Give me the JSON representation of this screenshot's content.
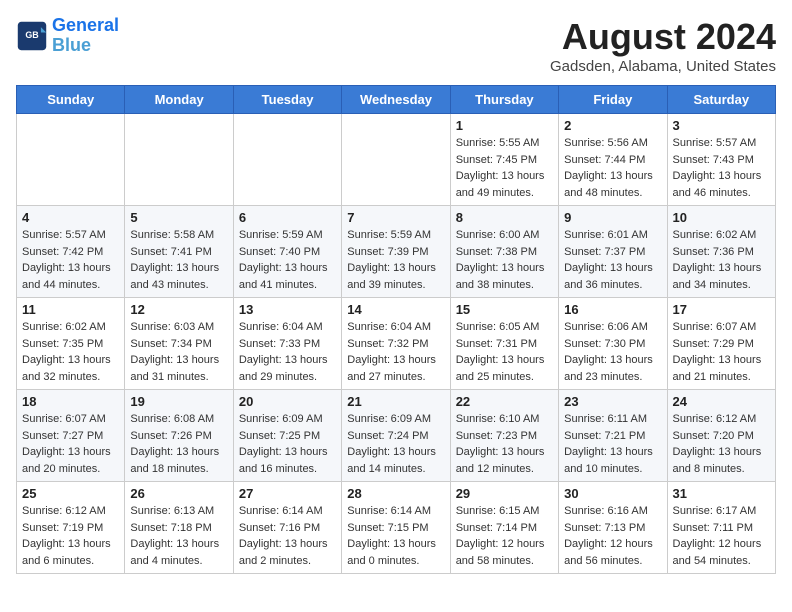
{
  "logo": {
    "line1": "General",
    "line2": "Blue"
  },
  "title": "August 2024",
  "location": "Gadsden, Alabama, United States",
  "days_of_week": [
    "Sunday",
    "Monday",
    "Tuesday",
    "Wednesday",
    "Thursday",
    "Friday",
    "Saturday"
  ],
  "weeks": [
    [
      {
        "day": "",
        "info": ""
      },
      {
        "day": "",
        "info": ""
      },
      {
        "day": "",
        "info": ""
      },
      {
        "day": "",
        "info": ""
      },
      {
        "day": "1",
        "info": "Sunrise: 5:55 AM\nSunset: 7:45 PM\nDaylight: 13 hours\nand 49 minutes."
      },
      {
        "day": "2",
        "info": "Sunrise: 5:56 AM\nSunset: 7:44 PM\nDaylight: 13 hours\nand 48 minutes."
      },
      {
        "day": "3",
        "info": "Sunrise: 5:57 AM\nSunset: 7:43 PM\nDaylight: 13 hours\nand 46 minutes."
      }
    ],
    [
      {
        "day": "4",
        "info": "Sunrise: 5:57 AM\nSunset: 7:42 PM\nDaylight: 13 hours\nand 44 minutes."
      },
      {
        "day": "5",
        "info": "Sunrise: 5:58 AM\nSunset: 7:41 PM\nDaylight: 13 hours\nand 43 minutes."
      },
      {
        "day": "6",
        "info": "Sunrise: 5:59 AM\nSunset: 7:40 PM\nDaylight: 13 hours\nand 41 minutes."
      },
      {
        "day": "7",
        "info": "Sunrise: 5:59 AM\nSunset: 7:39 PM\nDaylight: 13 hours\nand 39 minutes."
      },
      {
        "day": "8",
        "info": "Sunrise: 6:00 AM\nSunset: 7:38 PM\nDaylight: 13 hours\nand 38 minutes."
      },
      {
        "day": "9",
        "info": "Sunrise: 6:01 AM\nSunset: 7:37 PM\nDaylight: 13 hours\nand 36 minutes."
      },
      {
        "day": "10",
        "info": "Sunrise: 6:02 AM\nSunset: 7:36 PM\nDaylight: 13 hours\nand 34 minutes."
      }
    ],
    [
      {
        "day": "11",
        "info": "Sunrise: 6:02 AM\nSunset: 7:35 PM\nDaylight: 13 hours\nand 32 minutes."
      },
      {
        "day": "12",
        "info": "Sunrise: 6:03 AM\nSunset: 7:34 PM\nDaylight: 13 hours\nand 31 minutes."
      },
      {
        "day": "13",
        "info": "Sunrise: 6:04 AM\nSunset: 7:33 PM\nDaylight: 13 hours\nand 29 minutes."
      },
      {
        "day": "14",
        "info": "Sunrise: 6:04 AM\nSunset: 7:32 PM\nDaylight: 13 hours\nand 27 minutes."
      },
      {
        "day": "15",
        "info": "Sunrise: 6:05 AM\nSunset: 7:31 PM\nDaylight: 13 hours\nand 25 minutes."
      },
      {
        "day": "16",
        "info": "Sunrise: 6:06 AM\nSunset: 7:30 PM\nDaylight: 13 hours\nand 23 minutes."
      },
      {
        "day": "17",
        "info": "Sunrise: 6:07 AM\nSunset: 7:29 PM\nDaylight: 13 hours\nand 21 minutes."
      }
    ],
    [
      {
        "day": "18",
        "info": "Sunrise: 6:07 AM\nSunset: 7:27 PM\nDaylight: 13 hours\nand 20 minutes."
      },
      {
        "day": "19",
        "info": "Sunrise: 6:08 AM\nSunset: 7:26 PM\nDaylight: 13 hours\nand 18 minutes."
      },
      {
        "day": "20",
        "info": "Sunrise: 6:09 AM\nSunset: 7:25 PM\nDaylight: 13 hours\nand 16 minutes."
      },
      {
        "day": "21",
        "info": "Sunrise: 6:09 AM\nSunset: 7:24 PM\nDaylight: 13 hours\nand 14 minutes."
      },
      {
        "day": "22",
        "info": "Sunrise: 6:10 AM\nSunset: 7:23 PM\nDaylight: 13 hours\nand 12 minutes."
      },
      {
        "day": "23",
        "info": "Sunrise: 6:11 AM\nSunset: 7:21 PM\nDaylight: 13 hours\nand 10 minutes."
      },
      {
        "day": "24",
        "info": "Sunrise: 6:12 AM\nSunset: 7:20 PM\nDaylight: 13 hours\nand 8 minutes."
      }
    ],
    [
      {
        "day": "25",
        "info": "Sunrise: 6:12 AM\nSunset: 7:19 PM\nDaylight: 13 hours\nand 6 minutes."
      },
      {
        "day": "26",
        "info": "Sunrise: 6:13 AM\nSunset: 7:18 PM\nDaylight: 13 hours\nand 4 minutes."
      },
      {
        "day": "27",
        "info": "Sunrise: 6:14 AM\nSunset: 7:16 PM\nDaylight: 13 hours\nand 2 minutes."
      },
      {
        "day": "28",
        "info": "Sunrise: 6:14 AM\nSunset: 7:15 PM\nDaylight: 13 hours\nand 0 minutes."
      },
      {
        "day": "29",
        "info": "Sunrise: 6:15 AM\nSunset: 7:14 PM\nDaylight: 12 hours\nand 58 minutes."
      },
      {
        "day": "30",
        "info": "Sunrise: 6:16 AM\nSunset: 7:13 PM\nDaylight: 12 hours\nand 56 minutes."
      },
      {
        "day": "31",
        "info": "Sunrise: 6:17 AM\nSunset: 7:11 PM\nDaylight: 12 hours\nand 54 minutes."
      }
    ]
  ]
}
